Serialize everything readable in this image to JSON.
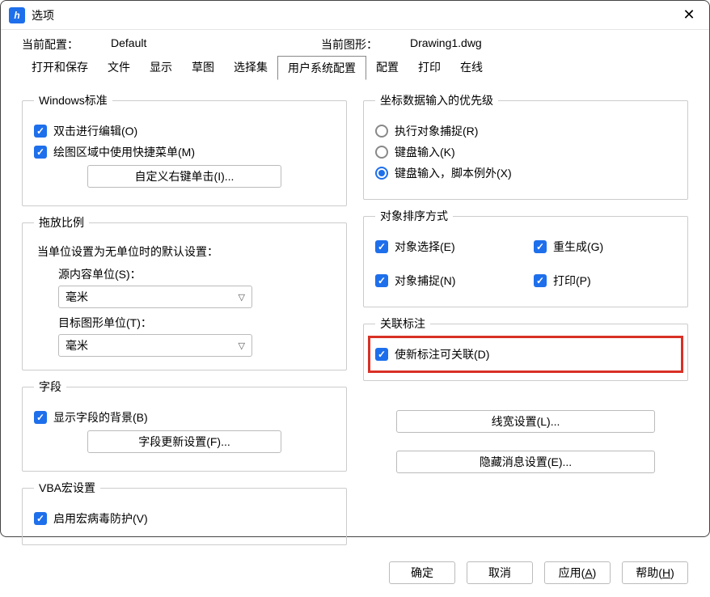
{
  "titlebar": {
    "title": "选项",
    "app_icon_text": "h"
  },
  "config": {
    "current_config_label": "当前配置：",
    "current_config_value": "Default",
    "current_drawing_label": "当前图形：",
    "current_drawing_value": "Drawing1.dwg"
  },
  "tabs": [
    "打开和保存",
    "文件",
    "显示",
    "草图",
    "选择集",
    "用户系统配置",
    "配置",
    "打印",
    "在线"
  ],
  "active_tab": "用户系统配置",
  "windows_std": {
    "legend": "Windows标准",
    "dbl_click_edit": "双击进行编辑(O)",
    "shortcut_menu": "绘图区域中使用快捷菜单(M)",
    "custom_rclick_btn": "自定义右键单击(I)..."
  },
  "scale": {
    "legend": "拖放比例",
    "default_note": "当单位设置为无单位时的默认设置：",
    "source_label": "源内容单位(S)：",
    "source_value": "毫米",
    "target_label": "目标图形单位(T)：",
    "target_value": "毫米"
  },
  "fields": {
    "legend": "字段",
    "show_bg": "显示字段的背景(B)",
    "update_btn": "字段更新设置(F)..."
  },
  "vba": {
    "legend": "VBA宏设置",
    "enable_av": "启用宏病毒防护(V)"
  },
  "coord_priority": {
    "legend": "坐标数据输入的优先级",
    "r1": "执行对象捕捉(R)",
    "r2": "键盘输入(K)",
    "r3": "键盘输入，脚本例外(X)"
  },
  "sort": {
    "legend": "对象排序方式",
    "obj_select": "对象选择(E)",
    "regen": "重生成(G)",
    "obj_snap": "对象捕捉(N)",
    "print": "打印(P)"
  },
  "assoc_dim": {
    "legend": "关联标注",
    "make_assoc": "使新标注可关联(D)"
  },
  "lineweight_btn": "线宽设置(L)...",
  "hidden_msg_btn": "隐藏消息设置(E)...",
  "footer": {
    "ok": "确定",
    "cancel": "取消",
    "apply": "应用(A)",
    "help": "帮助(H)"
  }
}
